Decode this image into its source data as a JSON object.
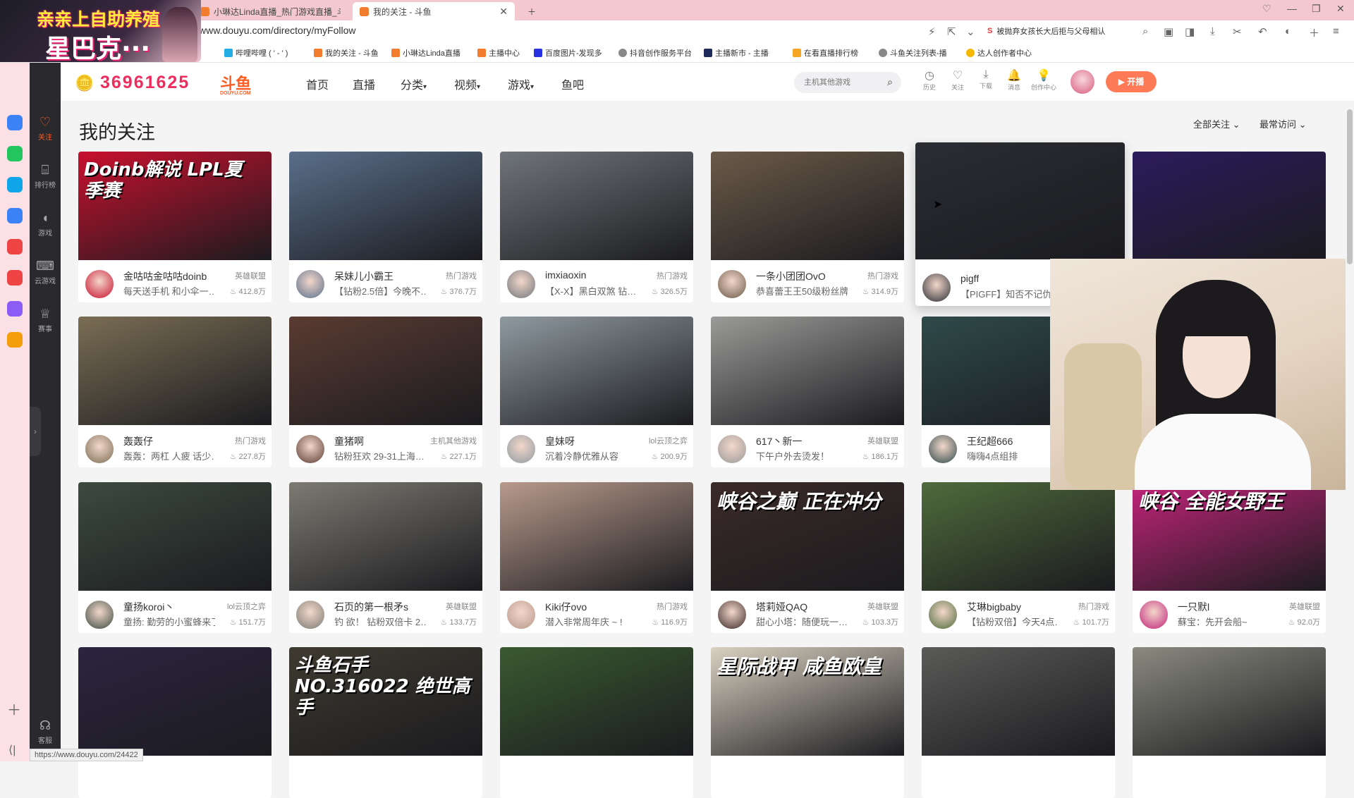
{
  "browser": {
    "tabs": [
      {
        "label": "亲亲上自助养殖"
      },
      {
        "label": "小琳达Linda直播_热门游戏直播_斗鱼"
      },
      {
        "label": "我的关注 - 斗鱼"
      }
    ],
    "new_tab_icon": "plus-icon",
    "url": "www.douyu.com/directory/myFollow",
    "search_hint": "被抛弃女孩长大后拒与父母相认",
    "bookmarks": [
      "哔哩哔哩 ( ' - ' )",
      "我的关注 - 斗鱼",
      "小琳达Linda直播",
      "主播中心",
      "百度图片-发现多",
      "抖音创作服务平台",
      "主播新市 - 主播",
      "在看直播排行榜",
      "斗鱼关注列表-播",
      "达人创作者中心"
    ],
    "status_url": "https://www.douyu.com/24422"
  },
  "promo": {
    "line1": "亲亲上自助养殖",
    "line2": "星巴克···"
  },
  "header": {
    "coin": "36961625",
    "logo": "斗鱼",
    "logo_sub": "DOUYU.COM",
    "nav": [
      "首页",
      "直播",
      "分类",
      "视频",
      "游戏",
      "鱼吧"
    ],
    "search_placeholder": "主机其他游戏",
    "tools": [
      "历史",
      "关注",
      "下载",
      "消息",
      "创作中心"
    ],
    "live_label": "开播"
  },
  "sidebar": {
    "items": [
      "关注",
      "排行榜",
      "游戏",
      "云游戏",
      "赛事"
    ],
    "service": "客服"
  },
  "main": {
    "title": "我的关注",
    "filter_all": "全部关注",
    "filter_sort": "最常访问"
  },
  "cards": [
    {
      "name": "金咕咕金咕咕doinb",
      "category": "英雄联盟",
      "desc": "每天送手机 和小伞一…",
      "pop": "412.8万",
      "overlay": "Doinb解说 LPL夏季赛",
      "color": "#c8102e"
    },
    {
      "name": "呆妹儿小霸王",
      "category": "热门游戏",
      "desc": "【钻粉2.5倍】今晚不…",
      "pop": "376.7万",
      "overlay": "",
      "color": "#5a6f8a"
    },
    {
      "name": "imxiaoxin",
      "category": "热门游戏",
      "desc": "【X-X】黑白双煞 钻…",
      "pop": "326.5万",
      "overlay": "",
      "color": "#70757a"
    },
    {
      "name": "一条小团团OvO",
      "category": "热门游戏",
      "desc": "恭喜蕾王王50级粉丝牌",
      "pop": "314.9万",
      "overlay": "",
      "color": "#6b5a48"
    },
    {
      "name": "pigff",
      "category": "",
      "desc": "【PIGFF】知否不记仇",
      "pop": "",
      "overlay": "",
      "color": "#2a2d33"
    },
    {
      "name": "",
      "category": "",
      "desc": "",
      "pop": "",
      "overlay": "",
      "color": "#2b1b5c"
    },
    {
      "name": "轰轰仔",
      "category": "热门游戏",
      "desc": "轰轰：两杠 人疲 话少…",
      "pop": "227.8万",
      "overlay": "",
      "color": "#7a6d54"
    },
    {
      "name": "童猪啊",
      "category": "主机其他游戏",
      "desc": "钻粉狂欢 29-31上海…",
      "pop": "227.1万",
      "overlay": "",
      "color": "#5a3b32"
    },
    {
      "name": "皇妹呀",
      "category": "lol云顶之弈",
      "desc": "沉着冷静优雅从容",
      "pop": "200.9万",
      "overlay": "",
      "color": "#8f9aa0"
    },
    {
      "name": "617丶新一",
      "category": "英雄联盟",
      "desc": "下午户外去烫发！",
      "pop": "186.1万",
      "overlay": "",
      "color": "#9a9a98"
    },
    {
      "name": "王纪超666",
      "category": "",
      "desc": "嗨嗨4点组排",
      "pop": "",
      "overlay": "",
      "color": "#2f4a4a"
    },
    {
      "name": "",
      "category": "",
      "desc": "",
      "pop": "",
      "overlay": "",
      "color": "#ddd"
    },
    {
      "name": "童扬koroi丶",
      "category": "lol云顶之弈",
      "desc": "童扬: 勤劳的小蜜蜂来了",
      "pop": "151.7万",
      "overlay": "",
      "color": "#3c4a40"
    },
    {
      "name": "石页的第一根矛s",
      "category": "英雄联盟",
      "desc": "钓 欲！ 钻粉双倍卡 2…",
      "pop": "133.7万",
      "overlay": "",
      "color": "#7c7a72"
    },
    {
      "name": "Kiki仔ovo",
      "category": "热门游戏",
      "desc": "潜入非常周年庆 ~ !",
      "pop": "116.9万",
      "overlay": "",
      "color": "#b89a8c"
    },
    {
      "name": "塔莉娅QAQ",
      "category": "英雄联盟",
      "desc": "甜心小塔：随便玩一…",
      "pop": "103.3万",
      "overlay": "峡谷之巅 正在冲分",
      "color": "#3b2a28"
    },
    {
      "name": "艾琳bigbaby",
      "category": "热门游戏",
      "desc": "【钻粉双倍】今天4点…",
      "pop": "101.7万",
      "overlay": "",
      "color": "#4f6b3b"
    },
    {
      "name": "一只默l",
      "category": "英雄联盟",
      "desc": "蘇宝：先开会船~",
      "pop": "92.0万",
      "overlay": "峡谷 全能女野王",
      "color": "#c2247a"
    },
    {
      "name": "",
      "category": "",
      "desc": "",
      "pop": "",
      "overlay": "",
      "color": "#2c2440"
    },
    {
      "name": "",
      "category": "",
      "desc": "",
      "pop": "",
      "overlay": "斗鱼石手 NO.316022 绝世高手",
      "color": "#3e3a30"
    },
    {
      "name": "",
      "category": "",
      "desc": "",
      "pop": "",
      "overlay": "",
      "color": "#3a5a30"
    },
    {
      "name": "",
      "category": "",
      "desc": "",
      "pop": "",
      "overlay": "星际战甲 咸鱼欧皇",
      "color": "#d9d0c0"
    },
    {
      "name": "",
      "category": "",
      "desc": "",
      "pop": "",
      "overlay": "",
      "color": "#5a5a58"
    },
    {
      "name": "",
      "category": "",
      "desc": "",
      "pop": "",
      "overlay": "",
      "color": "#8a8a80"
    }
  ]
}
